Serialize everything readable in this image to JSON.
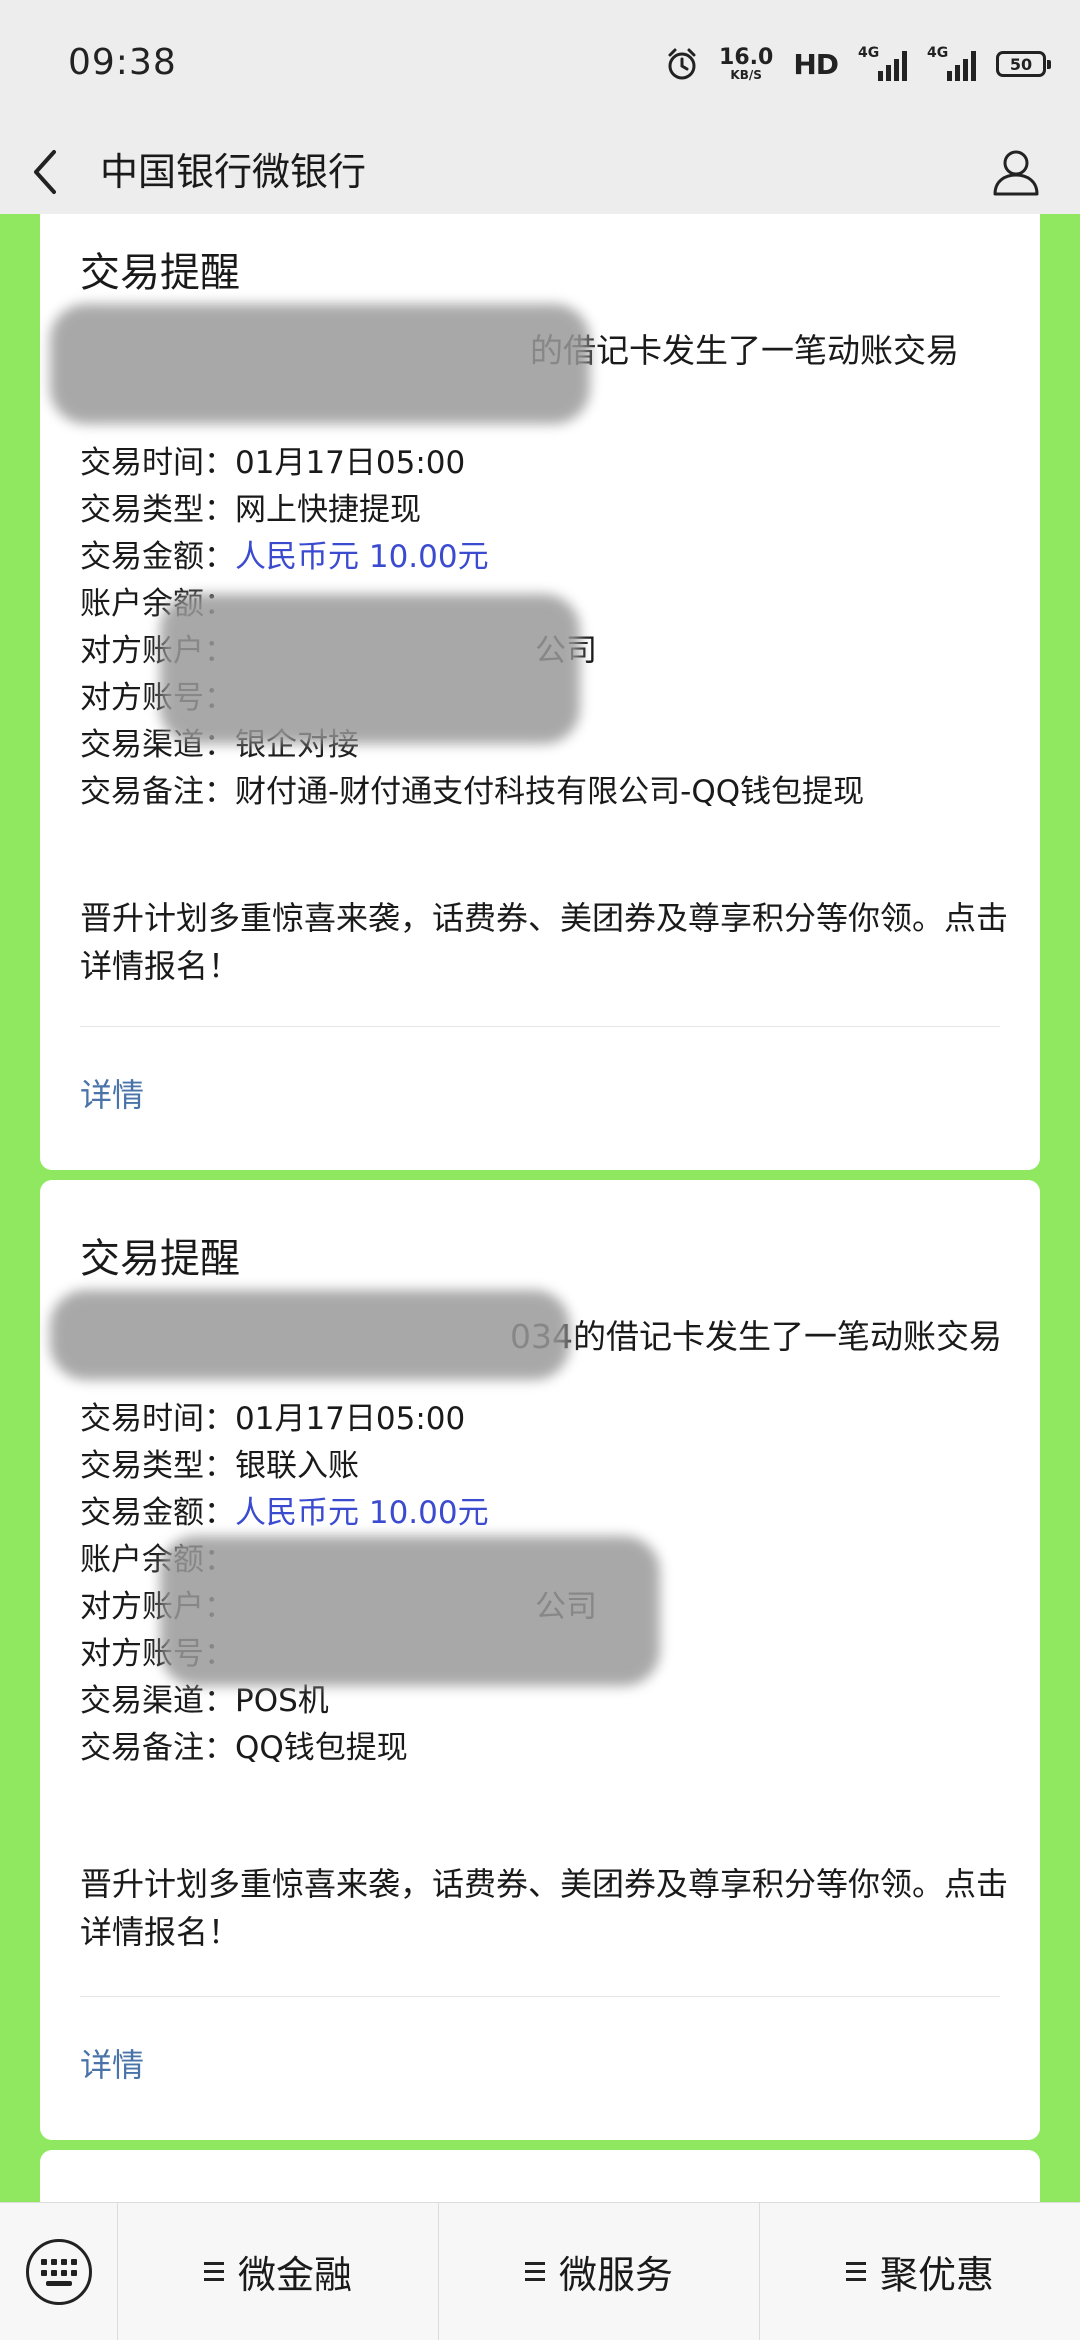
{
  "status": {
    "time": "09:38",
    "net_speed_value": "16.0",
    "net_speed_unit": "KB/S",
    "hd_label": "HD",
    "signal1_type": "4G",
    "signal2_type": "4G",
    "battery": "50"
  },
  "nav": {
    "title": "中国银行微银行"
  },
  "cards": [
    {
      "title": "交易提醒",
      "summary_visible": "的借记卡发生了一笔动账交易",
      "rows": [
        {
          "label": "交易时间",
          "value": "01月17日05:00"
        },
        {
          "label": "交易类型",
          "value": "网上快捷提现"
        },
        {
          "label": "交易金额",
          "value": "人民币元 10.00元"
        },
        {
          "label": "账户余额",
          "value": ""
        },
        {
          "label": "对方账户",
          "value": "公司"
        },
        {
          "label": "对方账号",
          "value": ""
        },
        {
          "label": "交易渠道",
          "value": "银企对接"
        },
        {
          "label": "交易备注",
          "value": "财付通-财付通支付科技有限公司-QQ钱包提现"
        }
      ],
      "promo": "晋升计划多重惊喜来袭，话费券、美团券及尊享积分等你领。点击详情报名！",
      "details_label": "详情"
    },
    {
      "title": "交易提醒",
      "summary_visible": "034的借记卡发生了一笔动账交易",
      "rows": [
        {
          "label": "交易时间",
          "value": "01月17日05:00"
        },
        {
          "label": "交易类型",
          "value": "银联入账"
        },
        {
          "label": "交易金额",
          "value": "人民币元 10.00元"
        },
        {
          "label": "账户余额",
          "value": ""
        },
        {
          "label": "对方账户",
          "value": "公司"
        },
        {
          "label": "对方账号",
          "value": ""
        },
        {
          "label": "交易渠道",
          "value": "POS机"
        },
        {
          "label": "交易备注",
          "value": "QQ钱包提现"
        }
      ],
      "promo": "晋升计划多重惊喜来袭，话费券、美团券及尊享积分等你领。点击详情报名！",
      "details_label": "详情"
    }
  ],
  "bottom_menu": [
    {
      "label": "微金融"
    },
    {
      "label": "微服务"
    },
    {
      "label": "聚优惠"
    }
  ],
  "colors": {
    "background_green": "#8fe85f",
    "amount_blue": "#3b4bd0",
    "link_blue": "#4a74a8"
  }
}
